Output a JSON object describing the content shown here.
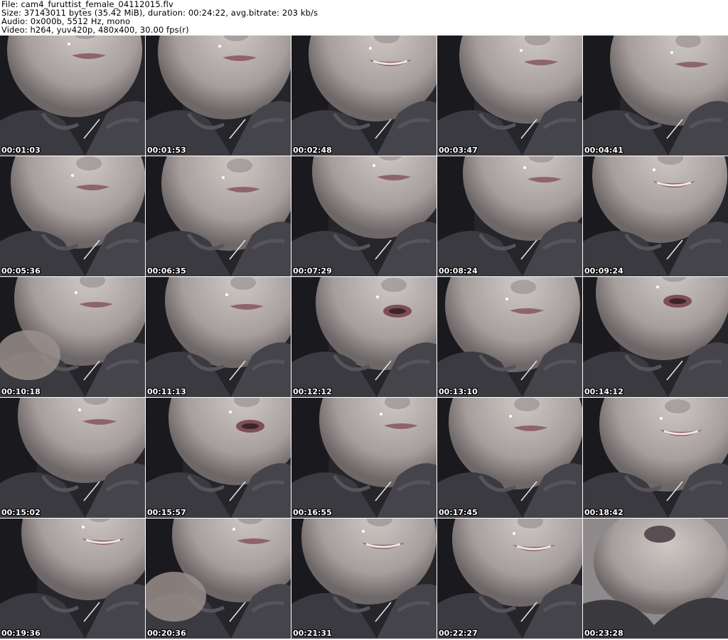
{
  "header": {
    "file_line": "File: cam4_furuttist_female_04112015.flv",
    "size_line": "Size: 37143011 bytes (35.42 MiB), duration: 00:24:22, avg.bitrate: 203 kb/s",
    "audio_line": "Audio: 0x000b, 5512 Hz, mono",
    "video_line": "Video: h264, yuv420p, 480x400, 30.00 fps(r)"
  },
  "thumbnails": [
    {
      "timestamp": "00:01:03",
      "scene": "face"
    },
    {
      "timestamp": "00:01:53",
      "scene": "face"
    },
    {
      "timestamp": "00:02:48",
      "scene": "face-smile"
    },
    {
      "timestamp": "00:03:47",
      "scene": "face"
    },
    {
      "timestamp": "00:04:41",
      "scene": "face"
    },
    {
      "timestamp": "00:05:36",
      "scene": "face"
    },
    {
      "timestamp": "00:06:35",
      "scene": "face"
    },
    {
      "timestamp": "00:07:29",
      "scene": "face"
    },
    {
      "timestamp": "00:08:24",
      "scene": "face"
    },
    {
      "timestamp": "00:09:24",
      "scene": "face-smile"
    },
    {
      "timestamp": "00:10:18",
      "scene": "face-hand"
    },
    {
      "timestamp": "00:11:13",
      "scene": "face"
    },
    {
      "timestamp": "00:12:12",
      "scene": "face-open"
    },
    {
      "timestamp": "00:13:10",
      "scene": "face"
    },
    {
      "timestamp": "00:14:12",
      "scene": "face-open"
    },
    {
      "timestamp": "00:15:02",
      "scene": "face"
    },
    {
      "timestamp": "00:15:57",
      "scene": "face-open"
    },
    {
      "timestamp": "00:16:55",
      "scene": "face"
    },
    {
      "timestamp": "00:17:45",
      "scene": "face"
    },
    {
      "timestamp": "00:18:42",
      "scene": "face-smile"
    },
    {
      "timestamp": "00:19:36",
      "scene": "face-smile"
    },
    {
      "timestamp": "00:20:36",
      "scene": "face-hand"
    },
    {
      "timestamp": "00:21:31",
      "scene": "face-smile"
    },
    {
      "timestamp": "00:22:27",
      "scene": "face-smile"
    },
    {
      "timestamp": "00:23:28",
      "scene": "neck"
    }
  ]
}
